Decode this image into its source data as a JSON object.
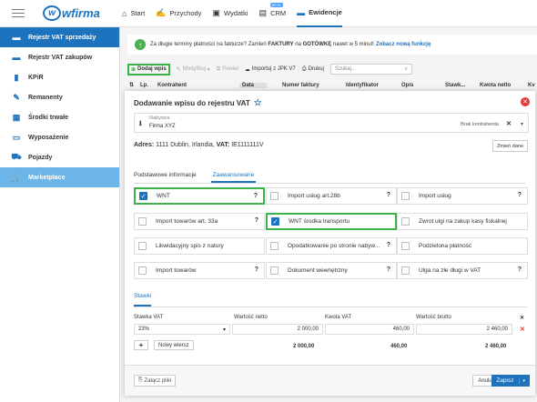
{
  "topbar": {
    "logo_text": "wfirma",
    "nav": [
      {
        "icon": "home-icon",
        "glyph": "⌂",
        "label": "Start"
      },
      {
        "icon": "income-icon",
        "glyph": "✍",
        "label": "Przychody"
      },
      {
        "icon": "wallet-icon",
        "glyph": "▣",
        "label": "Wydatki"
      },
      {
        "icon": "crm-icon",
        "glyph": "▤",
        "label": "CRM",
        "badge": "BETA"
      },
      {
        "icon": "folder-icon",
        "glyph": "▬",
        "label": "Ewidencje"
      }
    ]
  },
  "sidebar": {
    "items": [
      {
        "label": "Rejestr VAT sprzedaży",
        "icon": "folder-icon"
      },
      {
        "label": "Rejestr VAT zakupów",
        "icon": "folder-icon"
      },
      {
        "label": "KPiR",
        "icon": "book-icon"
      },
      {
        "label": "Remanenty",
        "icon": "ruler-icon"
      },
      {
        "label": "Środki trwałe",
        "icon": "building-icon"
      },
      {
        "label": "Wyposażenie",
        "icon": "laptop-icon"
      },
      {
        "label": "Pojazdy",
        "icon": "car-icon"
      },
      {
        "label": "Marketplace",
        "icon": "cart-icon"
      }
    ]
  },
  "banner": {
    "text": "Za długie terminy płatności na fakturze? Zamień",
    "bold1": "FAKTURY",
    "mid": "na",
    "bold2": "GOTÓWKĘ",
    "tail": "nawet w 5 minut!",
    "link": "Zobacz nową funkcję"
  },
  "toolbar": {
    "add": "Dodaj wpis",
    "modify": "Modyfikuj",
    "repeat": "Powiel",
    "import": "Importuj z JPK V7",
    "print": "Drukuj",
    "search_placeholder": "Szukaj..."
  },
  "table_header": [
    "Lp.",
    "Kontrahent",
    "Data",
    "Numer faktury",
    "Identyfikator",
    "Opis",
    "Stawk...",
    "Kwota netto",
    "Kv"
  ],
  "modal": {
    "title": "Dodawanie wpisu do rejestru VAT",
    "nabywca_label": "Nabywca",
    "nabywca_value": "Firma XYZ",
    "brak_kontrahenta": "Brak kontrahenta",
    "adres_label": "Adres:",
    "adres_value": "1111 Dublin, Irlandia,",
    "vat_label": "VAT:",
    "vat_value": "IE1111111V",
    "zmien_dane": "Zmień dane",
    "tabs": [
      "Podstawowe informacje",
      "Zaawansowane"
    ],
    "options": [
      {
        "label": "WNT",
        "checked": true,
        "help": true,
        "highlight": true
      },
      {
        "label": "Import usług art.28b",
        "checked": false,
        "help": true
      },
      {
        "label": "Import usług",
        "checked": false,
        "help": true
      },
      {
        "label": "Import towarów art. 33a",
        "checked": false,
        "help": true
      },
      {
        "label": "WNT środka transportu",
        "checked": true,
        "help": false,
        "highlight": true
      },
      {
        "label": "Zwrot ulgi na zakup kasy fiskalnej",
        "checked": false,
        "help": false
      },
      {
        "label": "Likwidacyjny spis z natury",
        "checked": false,
        "help": false
      },
      {
        "label": "Opodatkowanie po stronie nabyw...",
        "checked": false,
        "help": true
      },
      {
        "label": "Podzielona płatność",
        "checked": false,
        "help": false
      },
      {
        "label": "Import towarów",
        "checked": false,
        "help": true
      },
      {
        "label": "Dokument wewnętrzny",
        "checked": false,
        "help": true
      },
      {
        "label": "Ulga na złe długi w VAT",
        "checked": false,
        "help": true
      }
    ],
    "stawki_tab": "Stawki",
    "grid_headers": [
      "Stawka VAT",
      "Wartość netto",
      "Kwota VAT",
      "Wartość brutto"
    ],
    "row": {
      "stawka": "23%",
      "netto": "2 000,00",
      "vat": "460,00",
      "brutto": "2 460,00"
    },
    "add_row": "Nowy wiersz",
    "totals": {
      "netto": "2 000,00",
      "vat": "460,00",
      "brutto": "2 460,00"
    },
    "attach": "Załącz pliki",
    "cancel": "Anuluj",
    "save": "Zapisz"
  },
  "colors": {
    "accent": "#1e73be",
    "highlight": "#3cb04a",
    "danger": "#e53935"
  }
}
